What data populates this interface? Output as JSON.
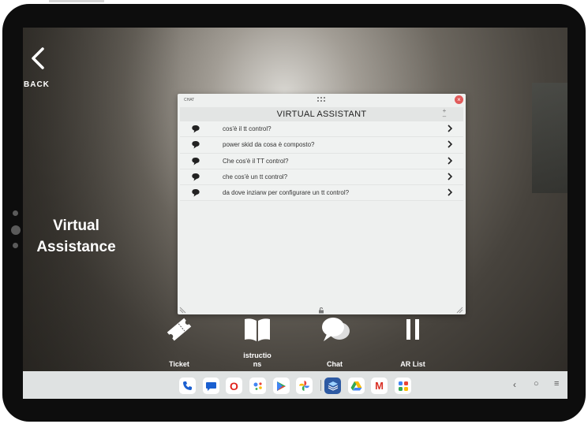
{
  "back": {
    "label": "BACK"
  },
  "panel_title": "Virtual Assistance",
  "chat": {
    "tag": "CHAT",
    "title": "VIRTUAL ASSISTANT",
    "questions": [
      "cos'è il tt control?",
      "power skid da cosa è composto?",
      "Che cos'è il TT control?",
      "che cos'è un tt control?",
      "da dove inziarw per configurare un tt control?"
    ]
  },
  "toolbar": {
    "ticket": "Ticket",
    "instructions_line1": "istructio",
    "instructions_line2": "ns",
    "chat": "Chat",
    "ar_list": "AR List"
  },
  "dock": {
    "apps": [
      "phone-icon",
      "messages-icon",
      "opera-icon",
      "assistant-icon",
      "play-store-icon",
      "photos-icon",
      "layers-app-icon",
      "drive-icon",
      "gmail-icon",
      "apps-grid-icon"
    ],
    "opera_glyph": "O",
    "gmail_glyph": "M"
  },
  "system_nav": {
    "back": "‹",
    "home": "○",
    "recents": "≡"
  },
  "colors": {
    "close": "#e05a5a",
    "chat_bg": "#eef0ef",
    "navbar": "#dfe2e2"
  }
}
